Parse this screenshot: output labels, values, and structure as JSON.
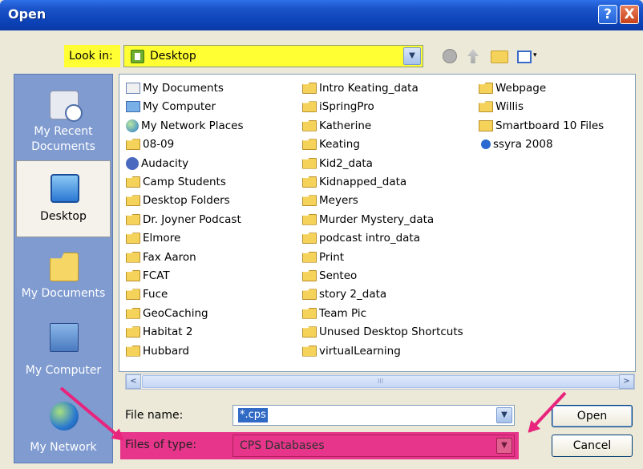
{
  "window": {
    "title": "Open"
  },
  "titlebar": {
    "help_label": "?",
    "close_label": "X"
  },
  "lookin": {
    "label": "Look in:",
    "value": "Desktop",
    "arrow": "▼"
  },
  "toolbar": {
    "icons": [
      "back-icon",
      "up-folder-icon",
      "new-folder-icon",
      "views-menu-icon"
    ],
    "views_arrow": "▾"
  },
  "places": [
    {
      "label1": "My Recent",
      "label2": "Documents",
      "icon": "recent-documents-icon"
    },
    {
      "label1": "Desktop",
      "label2": "",
      "icon": "desktop-icon"
    },
    {
      "label1": "My Documents",
      "label2": "",
      "icon": "my-documents-icon"
    },
    {
      "label1": "My Computer",
      "label2": "",
      "icon": "my-computer-icon"
    },
    {
      "label1": "My Network",
      "label2": "",
      "icon": "my-network-icon"
    }
  ],
  "files": {
    "col1": [
      {
        "name": "My Documents",
        "icon": "document-folder-icon"
      },
      {
        "name": "My Computer",
        "icon": "computer-icon"
      },
      {
        "name": "My Network Places",
        "icon": "network-places-icon"
      },
      {
        "name": "08-09",
        "icon": "folder-icon"
      },
      {
        "name": "Audacity",
        "icon": "audacity-icon"
      },
      {
        "name": "Camp Students",
        "icon": "folder-icon"
      },
      {
        "name": "Desktop Folders",
        "icon": "folder-icon"
      },
      {
        "name": "Dr. Joyner Podcast",
        "icon": "folder-icon"
      },
      {
        "name": "Elmore",
        "icon": "folder-icon"
      },
      {
        "name": "Fax Aaron",
        "icon": "folder-icon"
      },
      {
        "name": "FCAT",
        "icon": "folder-icon"
      },
      {
        "name": "Fuce",
        "icon": "folder-icon"
      },
      {
        "name": "GeoCaching",
        "icon": "folder-icon"
      },
      {
        "name": "Habitat 2",
        "icon": "folder-icon"
      },
      {
        "name": "Hubbard",
        "icon": "folder-icon"
      }
    ],
    "col2": [
      {
        "name": "Intro Keating_data",
        "icon": "folder-icon"
      },
      {
        "name": "iSpringPro",
        "icon": "folder-icon"
      },
      {
        "name": "Katherine",
        "icon": "folder-icon"
      },
      {
        "name": "Keating",
        "icon": "folder-icon"
      },
      {
        "name": "Kid2_data",
        "icon": "folder-icon"
      },
      {
        "name": "Kidnapped_data",
        "icon": "folder-icon"
      },
      {
        "name": "Meyers",
        "icon": "folder-icon"
      },
      {
        "name": "Murder Mystery_data",
        "icon": "folder-icon"
      },
      {
        "name": "podcast intro_data",
        "icon": "folder-icon"
      },
      {
        "name": "Print",
        "icon": "folder-icon"
      },
      {
        "name": "Senteo",
        "icon": "folder-icon"
      },
      {
        "name": "story 2_data",
        "icon": "folder-icon"
      },
      {
        "name": "Team Pic",
        "icon": "folder-icon"
      },
      {
        "name": "Unused Desktop Shortcuts",
        "icon": "folder-icon"
      },
      {
        "name": "virtualLearning",
        "icon": "folder-icon"
      }
    ],
    "col3": [
      {
        "name": "Webpage",
        "icon": "folder-icon"
      },
      {
        "name": "Willis",
        "icon": "folder-icon"
      },
      {
        "name": "Smartboard 10 Files",
        "icon": "shortcut-folder-icon"
      },
      {
        "name": "ssyra 2008",
        "icon": "ssyra-file-icon"
      }
    ]
  },
  "scrollbar": {
    "left_arrow": "<",
    "right_arrow": ">",
    "grip": "III"
  },
  "filename": {
    "label": "File name:",
    "value": "*.cps",
    "arrow": "▼"
  },
  "filetype": {
    "label": "Files of type:",
    "value": "CPS Databases",
    "arrow": "▼"
  },
  "buttons": {
    "open": "Open",
    "cancel": "Cancel"
  },
  "highlight_colors": {
    "lookin": "#ffff33",
    "filetype": "#e6358a",
    "arrow": "#e8247c"
  }
}
